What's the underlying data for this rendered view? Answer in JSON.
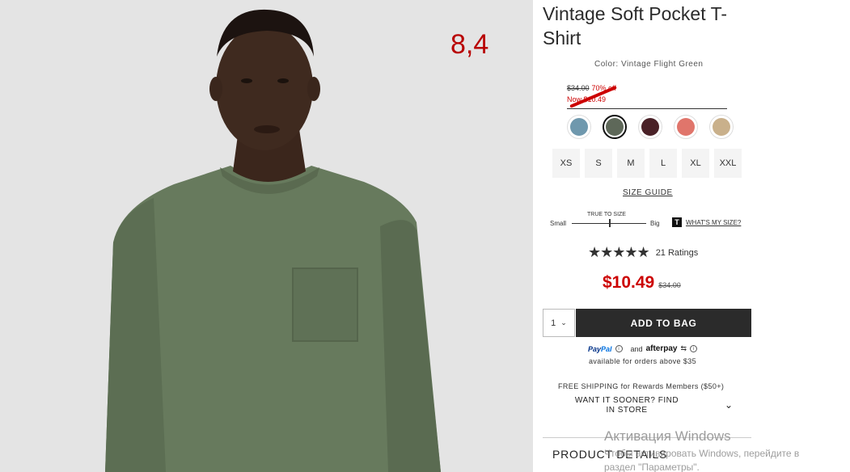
{
  "annotation": "8,4",
  "product": {
    "title": "Vintage Soft Pocket T-Shirt",
    "color_label": "Color: Vintage Flight Green",
    "old_price_line": "$34.00",
    "discount": "70% off",
    "now_line": "Now $10.49",
    "price": "$10.49",
    "price_original": "$34.00"
  },
  "swatches": [
    {
      "name": "blue",
      "color": "#6f98ad",
      "selected": false
    },
    {
      "name": "green",
      "color": "#5e6859",
      "selected": true
    },
    {
      "name": "burgundy",
      "color": "#4a2127",
      "selected": false
    },
    {
      "name": "coral",
      "color": "#e0756b",
      "selected": false
    },
    {
      "name": "khaki",
      "color": "#c9b08b",
      "selected": false
    }
  ],
  "sizes": [
    "XS",
    "S",
    "M",
    "L",
    "XL",
    "XXL"
  ],
  "size_guide": "SIZE GUIDE",
  "fit": {
    "true_to_size": "TRUE TO SIZE",
    "small": "Small",
    "big": "Big",
    "t_icon": "T",
    "whats_my_size": "WHAT'S MY SIZE?"
  },
  "rating": {
    "stars": "★★★★★",
    "value": 4.5,
    "count": "21 Ratings"
  },
  "cart": {
    "qty": "1",
    "add_to_bag": "ADD TO BAG"
  },
  "payment": {
    "paypal_1": "Pay",
    "paypal_2": "Pal",
    "and": "and",
    "afterpay": "afterpay",
    "available": "available for orders above $35"
  },
  "shipping": {
    "free": "FREE SHIPPING for Rewards Members ($50+)",
    "sooner": "WANT IT SOONER? FIND IN STORE"
  },
  "product_details": "PRODUCT DETAILS",
  "watermark": {
    "line1": "Активация Windows",
    "line2": "Чтобы активировать Windows, перейдите в",
    "line3": "раздел \"Параметры\"."
  }
}
